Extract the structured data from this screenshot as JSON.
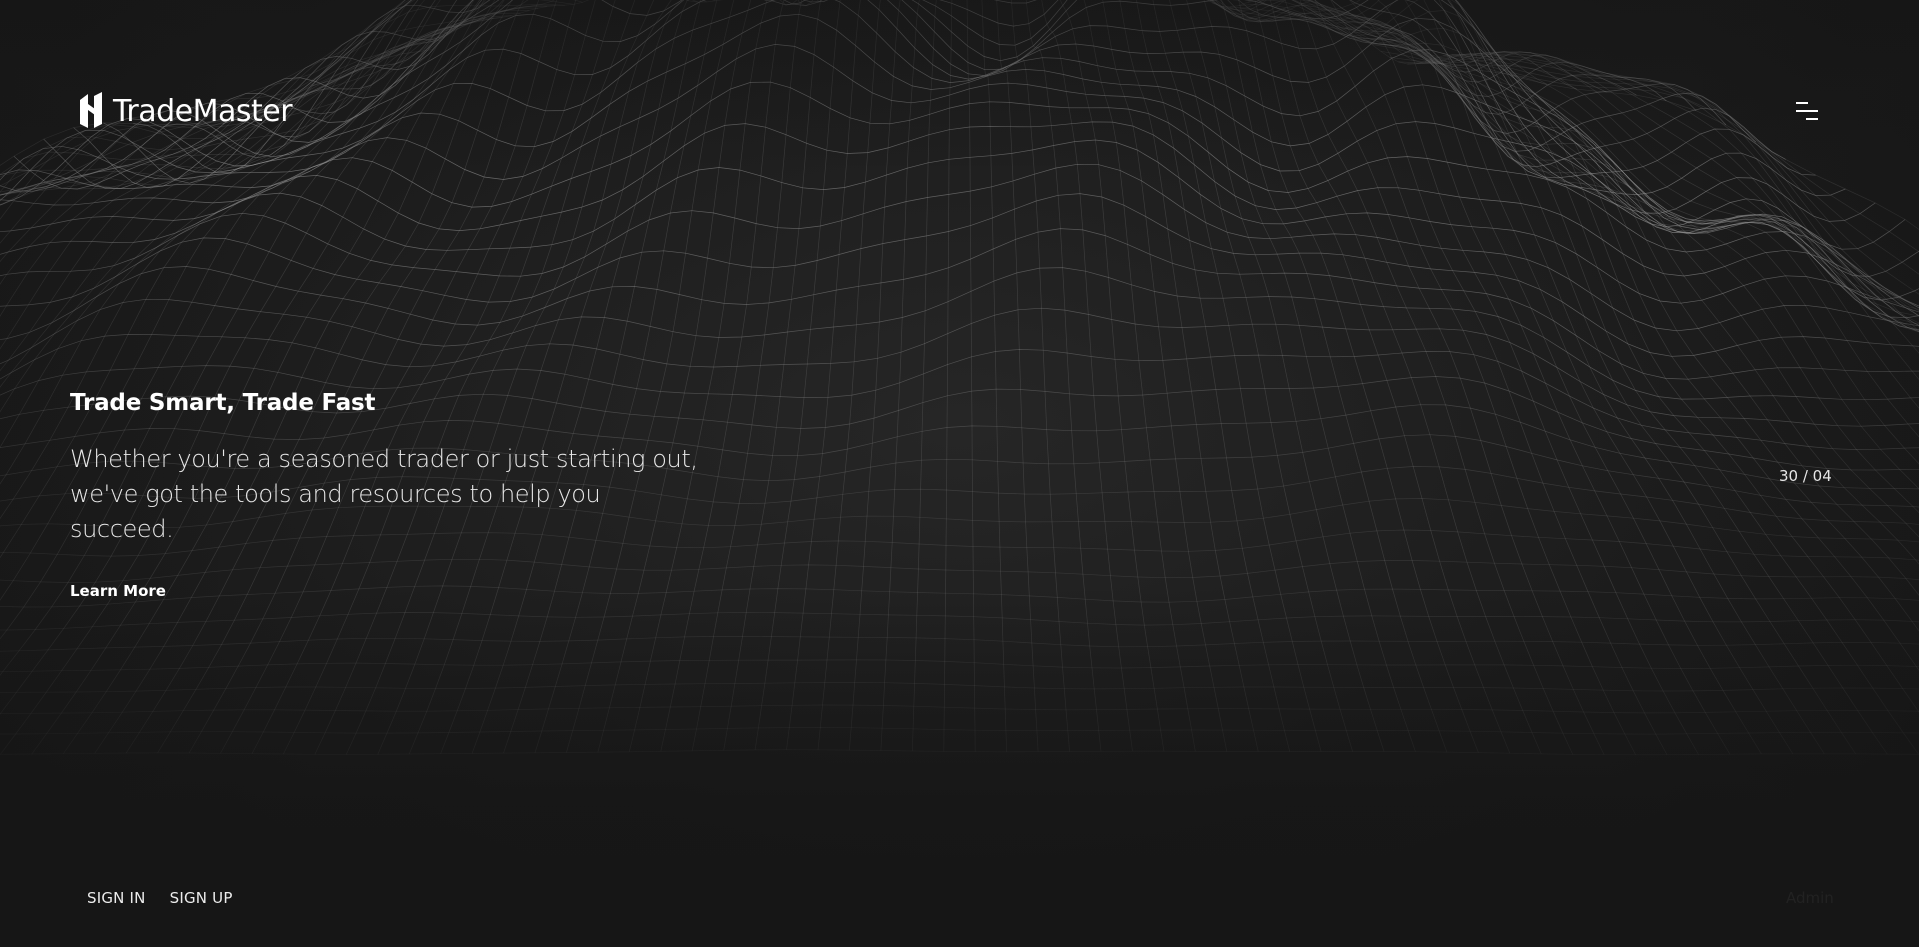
{
  "brand": {
    "name": "TradeMaster",
    "logo_icon": "trademaster-logo-icon"
  },
  "header": {
    "menu_icon": "hamburger-menu-icon"
  },
  "hero": {
    "title": "Trade Smart, Trade Fast",
    "subtitle_line1": "Whether you're a seasoned trader or just starting out,",
    "subtitle_line2": "we've got the tools and resources to help you succeed.",
    "cta_label": "Learn More"
  },
  "slider": {
    "counter": "30 / 04"
  },
  "footer": {
    "sign_in_label": "SIGN IN",
    "sign_up_label": "SIGN UP",
    "admin_label": "Admin"
  },
  "colors": {
    "background": "#1a1a1a",
    "text": "#ffffff",
    "mesh": "#9a9a9a"
  }
}
